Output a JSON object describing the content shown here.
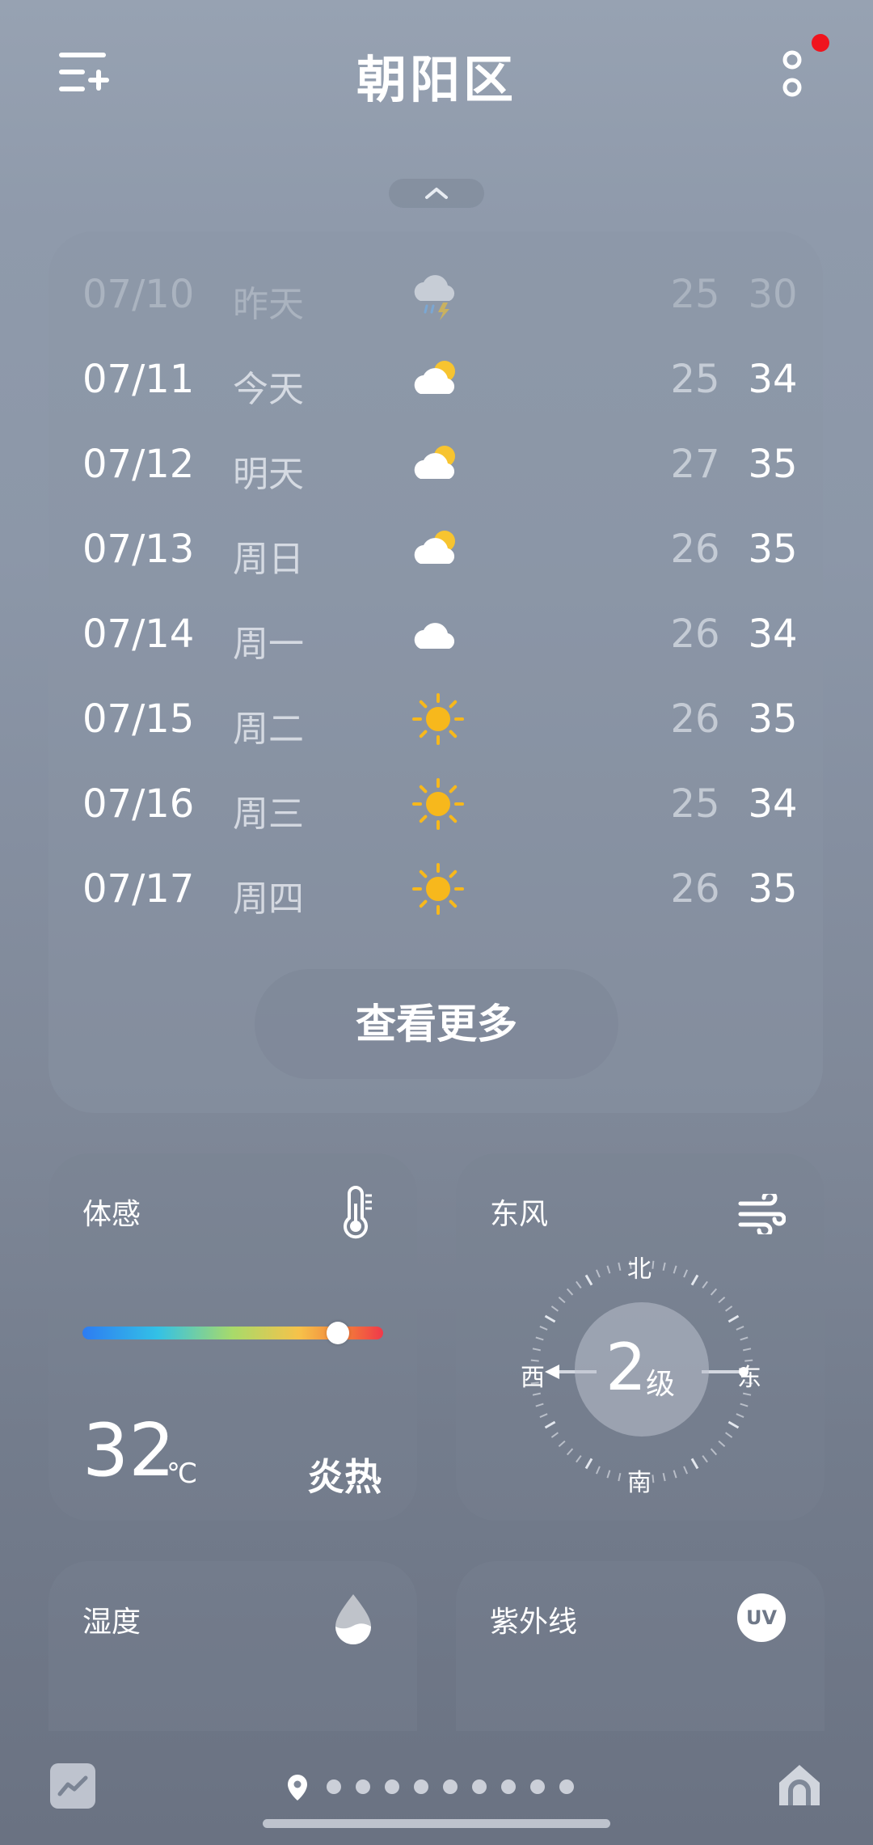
{
  "header": {
    "title": "朝阳区",
    "menu_icon": "add-city-menu-icon",
    "more_icon": "more-vertical-icon",
    "notification_dot_color": "#f0141e"
  },
  "forecast": {
    "days": [
      {
        "date": "07/10",
        "day": "昨天",
        "icon": "thunder-rain-icon",
        "low": "25",
        "high": "30",
        "past": true
      },
      {
        "date": "07/11",
        "day": "今天",
        "icon": "partly-cloudy-icon",
        "low": "25",
        "high": "34"
      },
      {
        "date": "07/12",
        "day": "明天",
        "icon": "partly-cloudy-icon",
        "low": "27",
        "high": "35"
      },
      {
        "date": "07/13",
        "day": "周日",
        "icon": "partly-cloudy-icon",
        "low": "26",
        "high": "35"
      },
      {
        "date": "07/14",
        "day": "周一",
        "icon": "cloudy-icon",
        "low": "26",
        "high": "34"
      },
      {
        "date": "07/15",
        "day": "周二",
        "icon": "sunny-icon",
        "low": "26",
        "high": "35"
      },
      {
        "date": "07/16",
        "day": "周三",
        "icon": "sunny-icon",
        "low": "25",
        "high": "34"
      },
      {
        "date": "07/17",
        "day": "周四",
        "icon": "sunny-icon",
        "low": "26",
        "high": "35"
      }
    ],
    "more_label": "查看更多"
  },
  "feels_like": {
    "label": "体感",
    "icon": "thermometer-icon",
    "value": "32",
    "unit": "℃",
    "description": "炎热",
    "bar_level": 0.85
  },
  "wind": {
    "label": "东风",
    "icon": "wind-icon",
    "level": "2",
    "level_unit": "级",
    "directions": {
      "north": "北",
      "south": "南",
      "west": "西",
      "east": "东"
    }
  },
  "humidity": {
    "label": "湿度",
    "icon": "water-drop-icon"
  },
  "uv": {
    "label": "紫外线",
    "icon": "uv-icon",
    "badge": "UV"
  },
  "bottom": {
    "trend_icon": "trend-chart-icon",
    "location_icon": "location-pin-icon",
    "page_count": 9,
    "home_icon": "home-icon"
  }
}
